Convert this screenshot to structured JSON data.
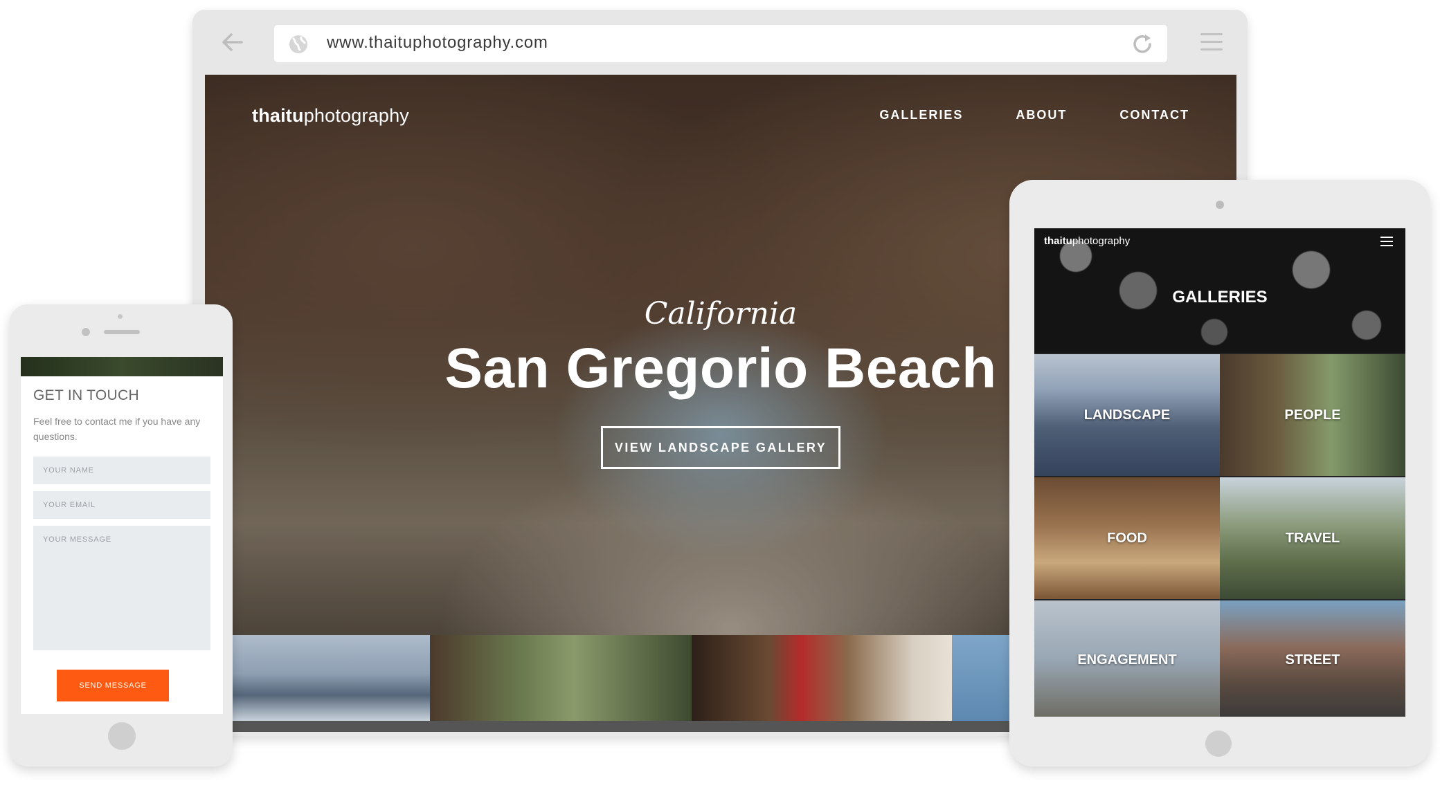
{
  "desktop": {
    "url": "www.thaituphotography.com",
    "logo_bold": "thaitu",
    "logo_light": "photography",
    "nav": [
      {
        "label": "GALLERIES"
      },
      {
        "label": "ABOUT"
      },
      {
        "label": "CONTACT"
      }
    ],
    "hero": {
      "subtitle": "California",
      "title": "San Gregorio Beach",
      "button": "VIEW LANDSCAPE GALLERY"
    }
  },
  "tablet": {
    "logo_bold": "thaitu",
    "logo_light": "photography",
    "header_title": "GALLERIES",
    "tiles": [
      {
        "label": "LANDSCAPE"
      },
      {
        "label": "PEOPLE"
      },
      {
        "label": "FOOD"
      },
      {
        "label": "TRAVEL"
      },
      {
        "label": "ENGAGEMENT"
      },
      {
        "label": "STREET"
      }
    ]
  },
  "phone": {
    "title": "GET IN TOUCH",
    "description": "Feel free to contact me if you have any questions.",
    "name_placeholder": "YOUR NAME",
    "email_placeholder": "YOUR EMAIL",
    "message_placeholder": "YOUR MESSAGE",
    "send_button": "SEND MESSAGE"
  },
  "colors": {
    "accent": "#ff5a12",
    "frame": "#e7e7e7"
  }
}
